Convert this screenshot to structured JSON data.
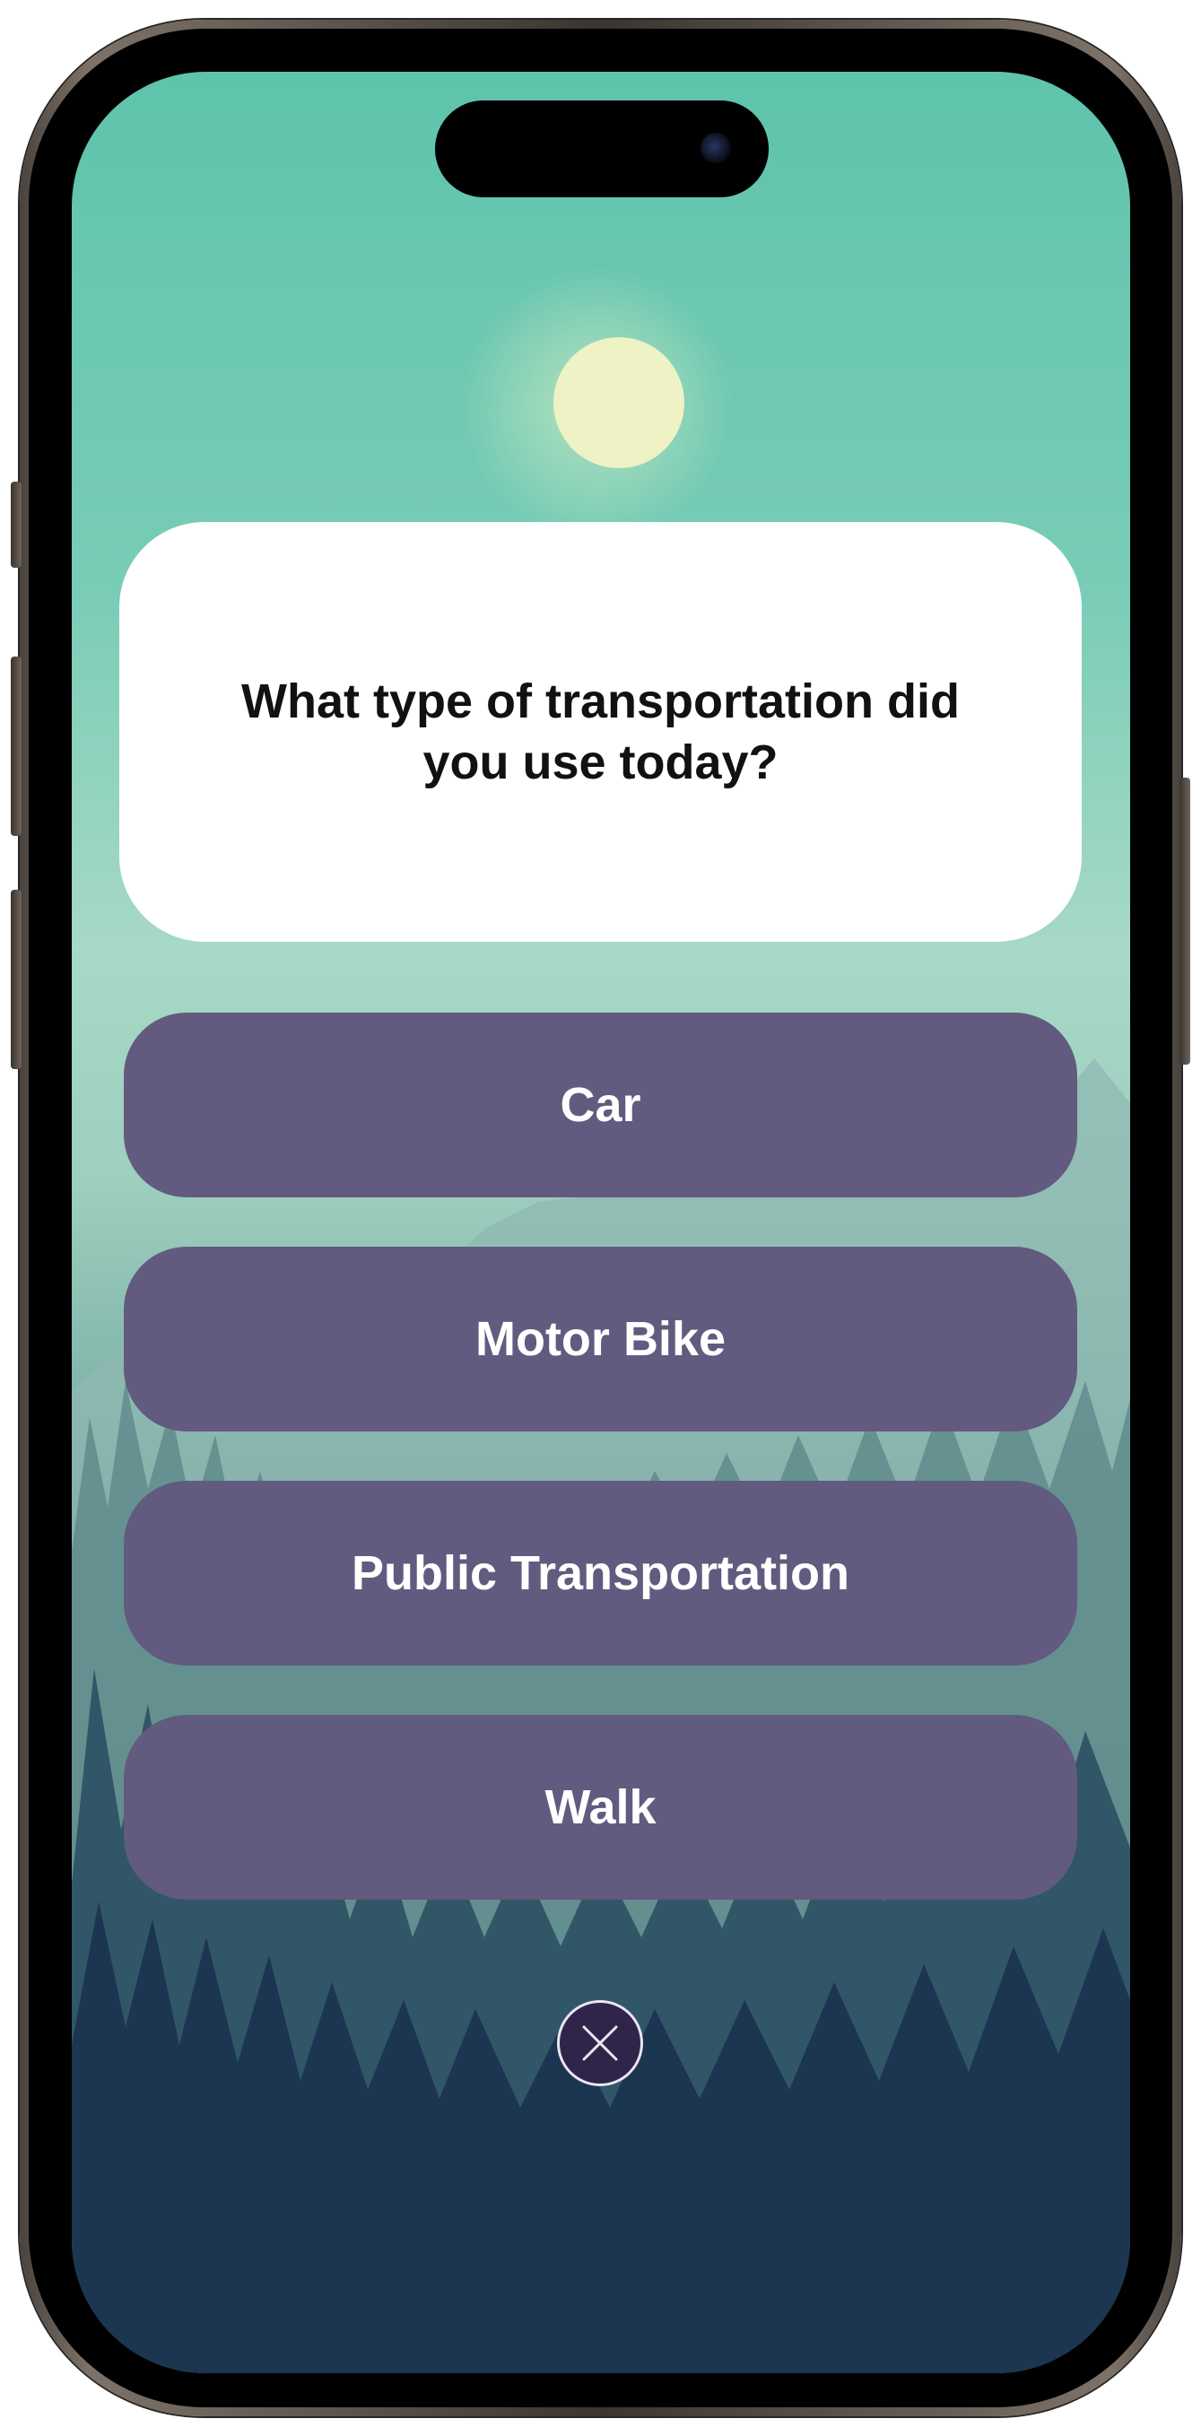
{
  "quiz": {
    "question": "What type of transportation did you use today?",
    "answers": [
      {
        "label": "Car"
      },
      {
        "label": "Motor Bike"
      },
      {
        "label": "Public Transportation"
      },
      {
        "label": "Walk"
      }
    ],
    "close_icon": "close-icon"
  },
  "colors": {
    "answer_button": "#625a7f",
    "question_card": "#ffffff",
    "close_button": "#2f2449",
    "sky_top": "#5fc3ac",
    "ground": "#182f4a"
  }
}
